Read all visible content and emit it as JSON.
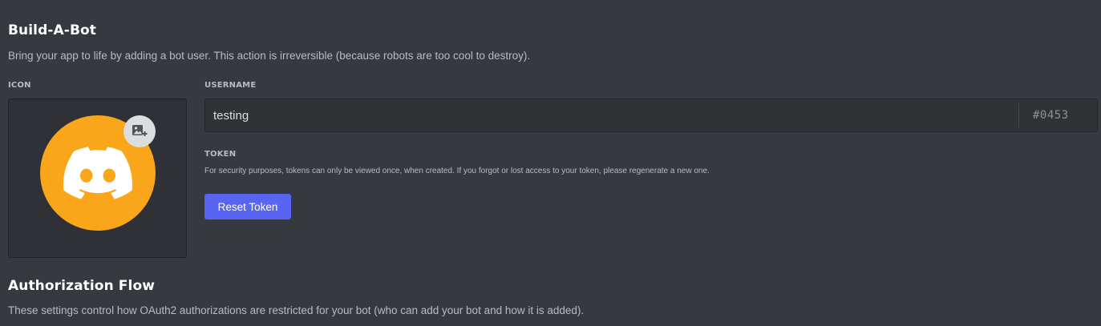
{
  "build_a_bot": {
    "title": "Build-A-Bot",
    "description": "Bring your app to life by adding a bot user. This action is irreversible (because robots are too cool to destroy).",
    "icon_label": "ICON",
    "avatar": {
      "background_color": "#faa61a",
      "icon": "discord-logo-icon",
      "upload_icon": "image-add-icon"
    },
    "username_label": "USERNAME",
    "username_value": "testing",
    "discriminator": "#0453",
    "token_label": "TOKEN",
    "token_description": "For security purposes, tokens can only be viewed once, when created. If you forgot or lost access to your token, please regenerate a new one.",
    "reset_token_label": "Reset Token",
    "button_color": "#5865f2"
  },
  "authorization_flow": {
    "title": "Authorization Flow",
    "description": "These settings control how OAuth2 authorizations are restricted for your bot (who can add your bot and how it is added)."
  }
}
